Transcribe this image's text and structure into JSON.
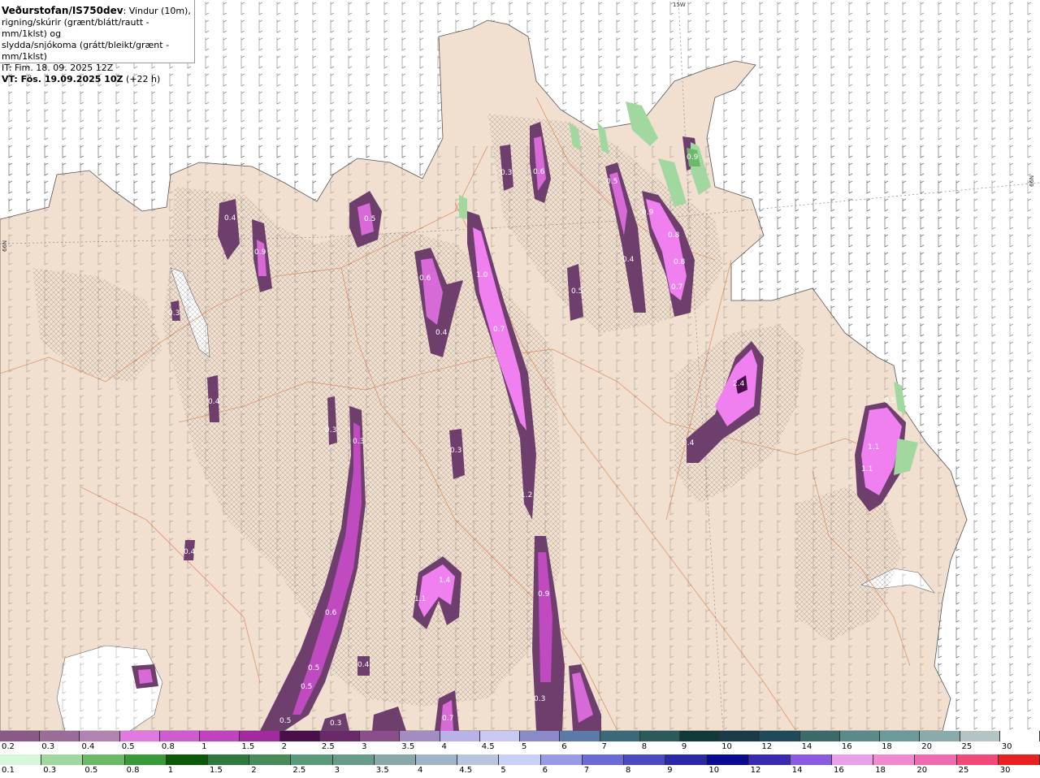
{
  "header": {
    "title_bold": "Veðurstofan/IS750dev",
    "title_rest": ": Vindur (10m),",
    "line2": "rigning/skúrir (grænt/blátt/rautt - mm/1klst) og",
    "line3": "slydda/snjókoma (grátt/bleikt/grænt - mm/1klst)",
    "it": "IT: Fim. 18. 09. 2025 12Z",
    "vt_bold": "VT: Fös. 19.09.2025 10Z",
    "vt_rest": " (+22 h)"
  },
  "grid_labels": {
    "top_lon": "15W",
    "right_lat": "66N",
    "left_lat": "66N"
  },
  "map_values": [
    {
      "text": "0.5"
    },
    {
      "text": "0.3"
    },
    {
      "text": "0.6"
    },
    {
      "text": "0.5"
    },
    {
      "text": "0.9"
    },
    {
      "text": "0.8"
    },
    {
      "text": "0.8"
    },
    {
      "text": "0.7"
    },
    {
      "text": "0.4"
    },
    {
      "text": "0.5"
    },
    {
      "text": "1.0"
    },
    {
      "text": "0.7"
    },
    {
      "text": "0.6"
    },
    {
      "text": "0.4"
    },
    {
      "text": "0.4"
    },
    {
      "text": "0.9"
    },
    {
      "text": "0.3"
    },
    {
      "text": "0.4"
    },
    {
      "text": "0.3"
    },
    {
      "text": "0.3"
    },
    {
      "text": "0.3"
    },
    {
      "text": "1.2"
    },
    {
      "text": "2.4"
    },
    {
      "text": "0.4"
    },
    {
      "text": "0.5"
    },
    {
      "text": "1.1"
    },
    {
      "text": "1.1"
    },
    {
      "text": "0.4"
    },
    {
      "text": "1.4"
    },
    {
      "text": "1.1"
    },
    {
      "text": "0.9"
    },
    {
      "text": "0.6"
    },
    {
      "text": "0.5"
    },
    {
      "text": "0.5"
    },
    {
      "text": "0.4"
    },
    {
      "text": "0.5"
    },
    {
      "text": "0.3"
    },
    {
      "text": "0.3"
    },
    {
      "text": "0.7"
    },
    {
      "text": "0.9"
    }
  ],
  "legend_snow": {
    "labels": [
      "0.2",
      "0.3",
      "0.4",
      "0.5",
      "0.8",
      "1",
      "1.5",
      "2",
      "2.5",
      "3",
      "3.5",
      "4",
      "4.5",
      "5",
      "6",
      "7",
      "8",
      "9",
      "10",
      "12",
      "14",
      "16",
      "18",
      "20",
      "25",
      "30"
    ],
    "colors": [
      "#8a5a86",
      "#9b6c98",
      "#b282b0",
      "#e07ae0",
      "#d05bd0",
      "#c042c0",
      "#a02a9e",
      "#4a0f4a",
      "#6a2a6a",
      "#8a4f8a",
      "#a38cc2",
      "#b8b2e8",
      "#c8c8f2",
      "#8a8ac8",
      "#5a7aa8",
      "#3a6a7a",
      "#2a5a5a",
      "#0f3a3a",
      "#1a3a4a",
      "#1e4a5a",
      "#3a6a6a",
      "#5a8a8a",
      "#6a9a9a",
      "#8aabab",
      "#b4c4c4",
      "#ffffff"
    ]
  },
  "legend_rain": {
    "labels": [
      "0.1",
      "0.3",
      "0.5",
      "0.8",
      "1",
      "1.5",
      "2",
      "2.5",
      "3",
      "3.5",
      "4",
      "4.5",
      "5",
      "6",
      "7",
      "8",
      "9",
      "10",
      "12",
      "14",
      "16",
      "18",
      "20",
      "25",
      "30"
    ],
    "colors": [
      "#d8f6d8",
      "#a0d8a0",
      "#6aba6a",
      "#3a9a3a",
      "#0a5a0a",
      "#2e7a3e",
      "#4a8a5a",
      "#5a9a7a",
      "#6a9a8a",
      "#8aa8a8",
      "#a0b4c8",
      "#b8c4e0",
      "#c8d0f8",
      "#9a9ae8",
      "#6a6ad8",
      "#4a4ac0",
      "#2a2aa8",
      "#0a0a90",
      "#3a2ab0",
      "#8a5ae0",
      "#e8a0e8",
      "#f08ad0",
      "#f06ab0",
      "#f04a78",
      "#e82020"
    ]
  }
}
